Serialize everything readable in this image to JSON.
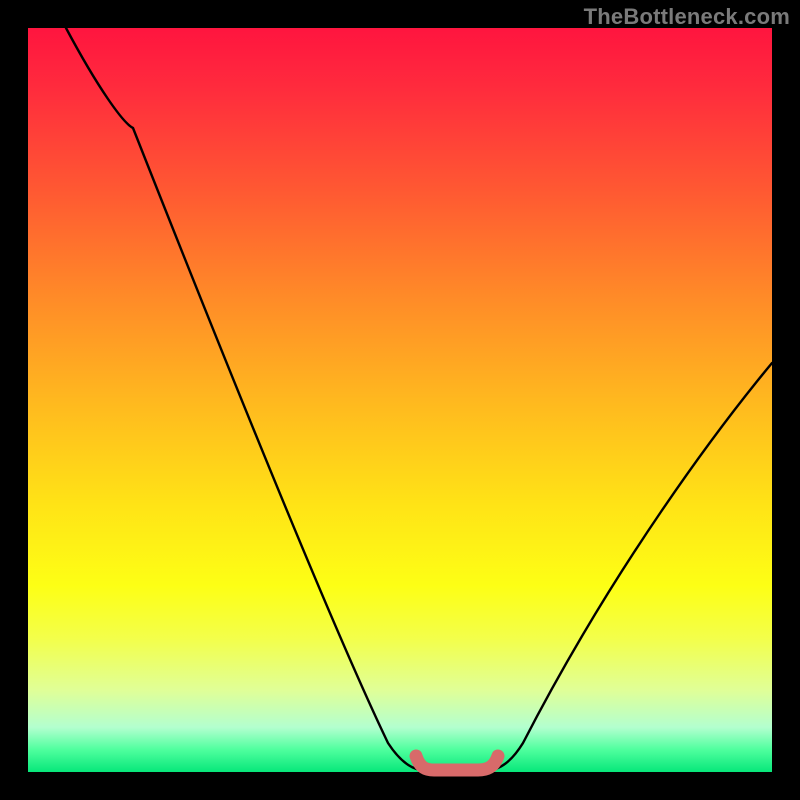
{
  "watermark": "TheBottleneck.com",
  "colors": {
    "background": "#000000",
    "curve": "#000000",
    "bottom_marker": "#d86a6a"
  },
  "chart_data": {
    "type": "line",
    "title": "",
    "xlabel": "",
    "ylabel": "",
    "xlim": [
      0,
      100
    ],
    "ylim": [
      0,
      100
    ],
    "series": [
      {
        "name": "curve-left-segment",
        "x": [
          5,
          14,
          49,
          53
        ],
        "y": [
          100,
          87,
          3,
          0
        ]
      },
      {
        "name": "curve-right-segment",
        "x": [
          62,
          66,
          100
        ],
        "y": [
          0,
          3,
          55
        ]
      },
      {
        "name": "bottom-highlight",
        "x": [
          52,
          54,
          61,
          63
        ],
        "y": [
          2,
          0,
          0,
          2
        ]
      }
    ],
    "annotations": []
  }
}
